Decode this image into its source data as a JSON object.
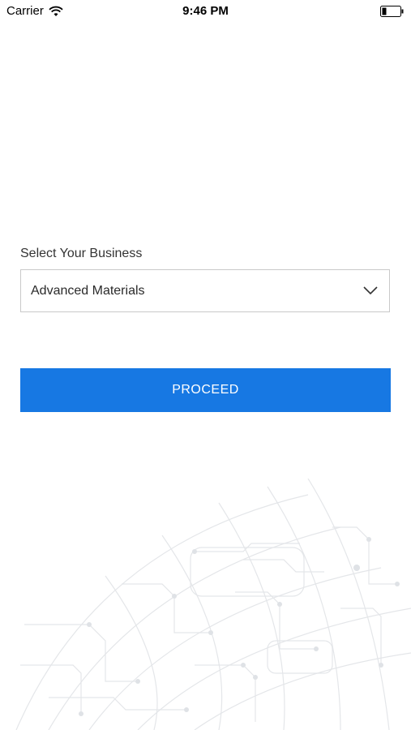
{
  "status_bar": {
    "carrier": "Carrier",
    "time": "9:46 PM"
  },
  "form": {
    "business_label": "Select Your Business",
    "business_selected": "Advanced Materials",
    "proceed_label": "PROCEED"
  },
  "icons": {
    "wifi": "wifi-icon",
    "battery": "battery-icon",
    "dropdown": "chevron-down-icon",
    "background": "circuit-globe-art"
  },
  "colors": {
    "accent": "#1778e3",
    "border": "#c9c9c9",
    "background": "#ffffff"
  }
}
